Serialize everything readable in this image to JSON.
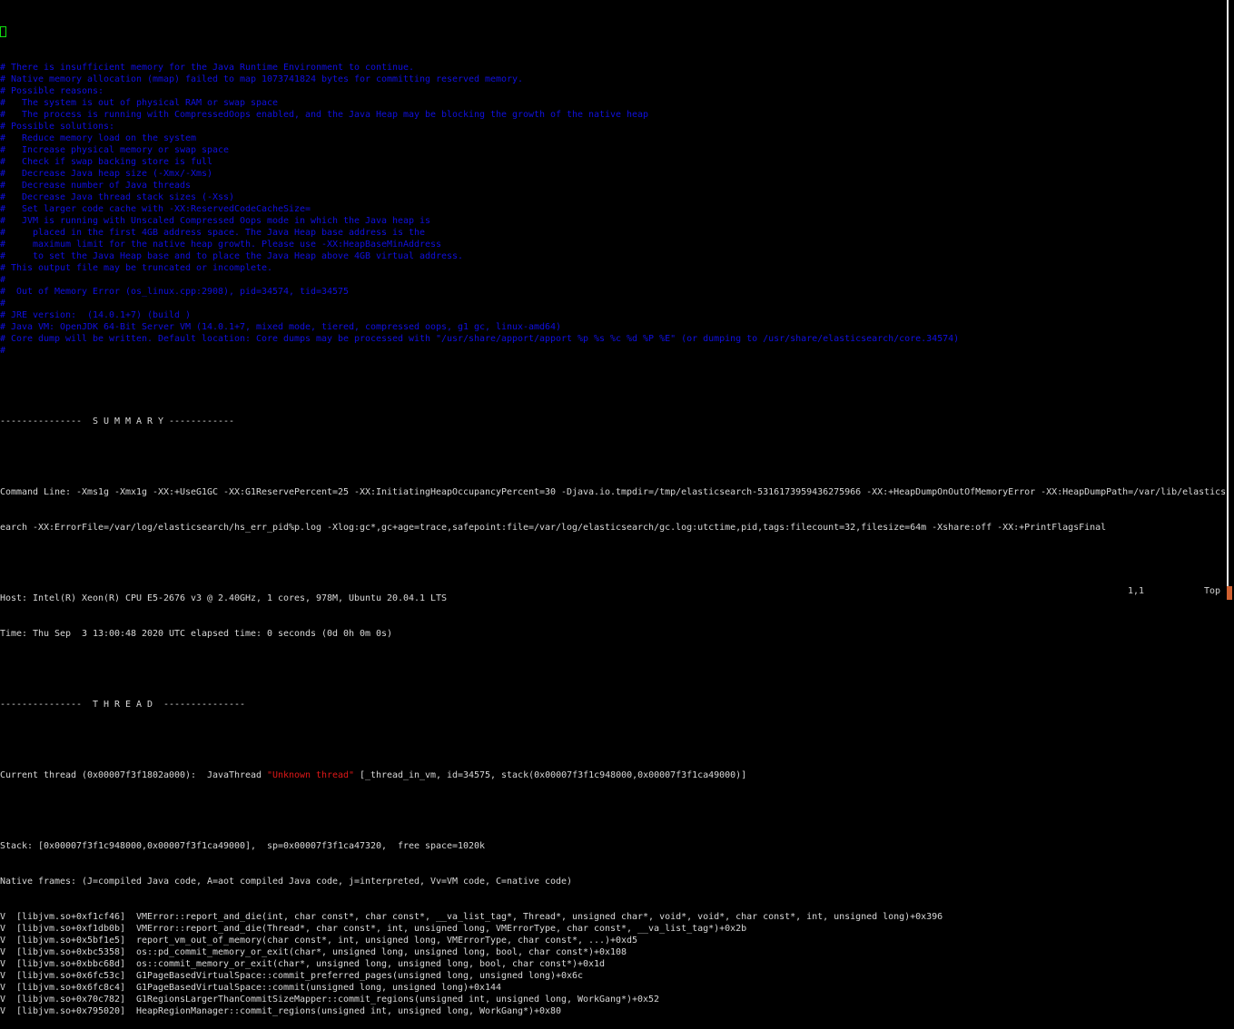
{
  "terminal": {
    "cursor_color": "#10e010",
    "header_comments": [
      "# There is insufficient memory for the Java Runtime Environment to continue.",
      "# Native memory allocation (mmap) failed to map 1073741824 bytes for committing reserved memory.",
      "# Possible reasons:",
      "#   The system is out of physical RAM or swap space",
      "#   The process is running with CompressedOops enabled, and the Java Heap may be blocking the growth of the native heap",
      "# Possible solutions:",
      "#   Reduce memory load on the system",
      "#   Increase physical memory or swap space",
      "#   Check if swap backing store is full",
      "#   Decrease Java heap size (-Xmx/-Xms)",
      "#   Decrease number of Java threads",
      "#   Decrease Java thread stack sizes (-Xss)",
      "#   Set larger code cache with -XX:ReservedCodeCacheSize=",
      "#   JVM is running with Unscaled Compressed Oops mode in which the Java heap is",
      "#     placed in the first 4GB address space. The Java Heap base address is the",
      "#     maximum limit for the native heap growth. Please use -XX:HeapBaseMinAddress",
      "#     to set the Java Heap base and to place the Java Heap above 4GB virtual address.",
      "# This output file may be truncated or incomplete.",
      "#",
      "#  Out of Memory Error (os_linux.cpp:2908), pid=34574, tid=34575",
      "#",
      "# JRE version:  (14.0.1+7) (build )",
      "# Java VM: OpenJDK 64-Bit Server VM (14.0.1+7, mixed mode, tiered, compressed oops, g1 gc, linux-amd64)",
      "# Core dump will be written. Default location: Core dumps may be processed with \"/usr/share/apport/apport %p %s %c %d %P %E\" (or dumping to /usr/share/elasticsearch/core.34574)",
      "#"
    ],
    "summary_header": "---------------  S U M M A R Y ------------",
    "command_line_1": "Command Line: -Xms1g -Xmx1g -XX:+UseG1GC -XX:G1ReservePercent=25 -XX:InitiatingHeapOccupancyPercent=30 -Djava.io.tmpdir=/tmp/elasticsearch-5316173959436275966 -XX:+HeapDumpOnOutOfMemoryError -XX:HeapDumpPath=/var/lib/elastics",
    "command_line_2": "earch -XX:ErrorFile=/var/log/elasticsearch/hs_err_pid%p.log -Xlog:gc*,gc+age=trace,safepoint:file=/var/log/elasticsearch/gc.log:utctime,pid,tags:filecount=32,filesize=64m -Xshare:off -XX:+PrintFlagsFinal",
    "host": "Host: Intel(R) Xeon(R) CPU E5-2676 v3 @ 2.40GHz, 1 cores, 978M, Ubuntu 20.04.1 LTS",
    "time": "Time: Thu Sep  3 13:00:48 2020 UTC elapsed time: 0 seconds (0d 0h 0m 0s)",
    "thread_header": "---------------  T H R E A D  ---------------",
    "current_thread_prefix": "Current thread (0x00007f3f1802a000):  JavaThread ",
    "current_thread_name": "\"Unknown thread\"",
    "current_thread_suffix": " [_thread_in_vm, id=34575, stack(0x00007f3f1c948000,0x00007f3f1ca49000)]",
    "stack": "Stack: [0x00007f3f1c948000,0x00007f3f1ca49000],  sp=0x00007f3f1ca47320,  free space=1020k",
    "native_frames": "Native frames: (J=compiled Java code, A=aot compiled Java code, j=interpreted, Vv=VM code, C=native code)",
    "frames": [
      "V  [libjvm.so+0xf1cf46]  VMError::report_and_die(int, char const*, char const*, __va_list_tag*, Thread*, unsigned char*, void*, void*, char const*, int, unsigned long)+0x396",
      "V  [libjvm.so+0xf1db0b]  VMError::report_and_die(Thread*, char const*, int, unsigned long, VMErrorType, char const*, __va_list_tag*)+0x2b",
      "V  [libjvm.so+0x5bf1e5]  report_vm_out_of_memory(char const*, int, unsigned long, VMErrorType, char const*, ...)+0xd5",
      "V  [libjvm.so+0xbc5358]  os::pd_commit_memory_or_exit(char*, unsigned long, unsigned long, bool, char const*)+0x108",
      "V  [libjvm.so+0xbbc68d]  os::commit_memory_or_exit(char*, unsigned long, unsigned long, bool, char const*)+0x1d",
      "V  [libjvm.so+0x6fc53c]  G1PageBasedVirtualSpace::commit_preferred_pages(unsigned long, unsigned long)+0x6c",
      "V  [libjvm.so+0x6fc8c4]  G1PageBasedVirtualSpace::commit(unsigned long, unsigned long)+0x144",
      "V  [libjvm.so+0x70c782]  G1RegionsLargerThanCommitSizeMapper::commit_regions(unsigned int, unsigned long, WorkGang*)+0x52",
      "V  [libjvm.so+0x795020]  HeapRegionManager::commit_regions(unsigned int, unsigned long, WorkGang*)+0x80"
    ]
  },
  "status_line": {
    "position": "1,1",
    "scroll": "Top"
  }
}
